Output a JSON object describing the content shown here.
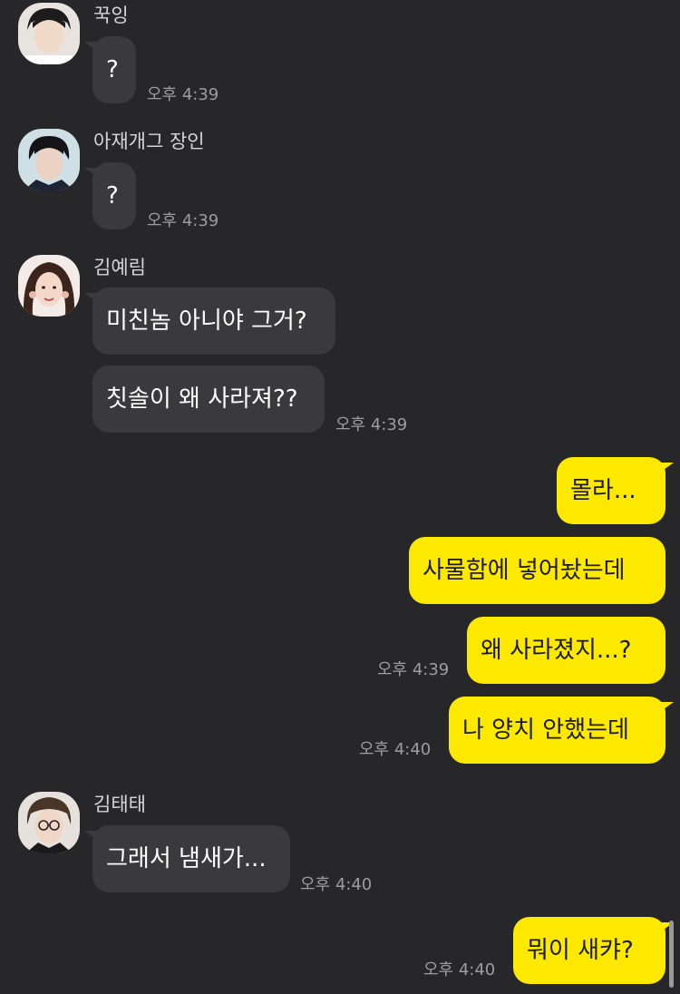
{
  "colors": {
    "background": "#27272a",
    "incoming_bubble": "#3a3a3d",
    "outgoing_bubble": "#fde900",
    "timestamp": "#9d9da1",
    "sender_name": "#d6d6d8"
  },
  "messages": [
    {
      "sender": "꾹잉",
      "avatar": "avatar-photo-icon",
      "text": "?",
      "time": "오후 4:39"
    },
    {
      "sender": "아재개그 장인",
      "avatar": "avatar-photo-icon",
      "text": "?",
      "time": "오후 4:39"
    },
    {
      "sender": "김예림",
      "avatar": "avatar-photo-icon",
      "texts": [
        "미친놈 아니야 그거?",
        "칫솔이 왜 사라져??"
      ],
      "time": "오후 4:39"
    },
    {
      "sender": "me",
      "texts": [
        "몰라...",
        "사물함에 넣어놨는데",
        "왜 사라졌지...?"
      ],
      "time": "오후 4:39"
    },
    {
      "sender": "me",
      "text": "나 양치 안했는데",
      "time": "오후 4:40"
    },
    {
      "sender": "김태태",
      "avatar": "avatar-photo-icon",
      "text": "그래서 냄새가...",
      "time": "오후 4:40"
    },
    {
      "sender": "me",
      "text": "뭐이 새캬?",
      "time": "오후 4:40"
    }
  ],
  "chat": {
    "g1": {
      "name": "꾹잉",
      "msg": "?",
      "time": "오후 4:39"
    },
    "g2": {
      "name": "아재개그 장인",
      "msg": "?",
      "time": "오후 4:39"
    },
    "g3": {
      "name": "김예림",
      "msg1": "미친놈 아니야 그거?",
      "msg2": "칫솔이 왜 사라져??",
      "time": "오후 4:39"
    },
    "g4": {
      "msg1": "몰라...",
      "msg2": "사물함에 넣어놨는데",
      "msg3": "왜 사라졌지...?",
      "time": "오후 4:39"
    },
    "g5": {
      "msg": "나 양치 안했는데",
      "time": "오후 4:40"
    },
    "g6": {
      "name": "김태태",
      "msg": "그래서 냄새가...",
      "time": "오후 4:40"
    },
    "g7": {
      "msg": "뭐이 새캬?",
      "time": "오후 4:40"
    }
  }
}
